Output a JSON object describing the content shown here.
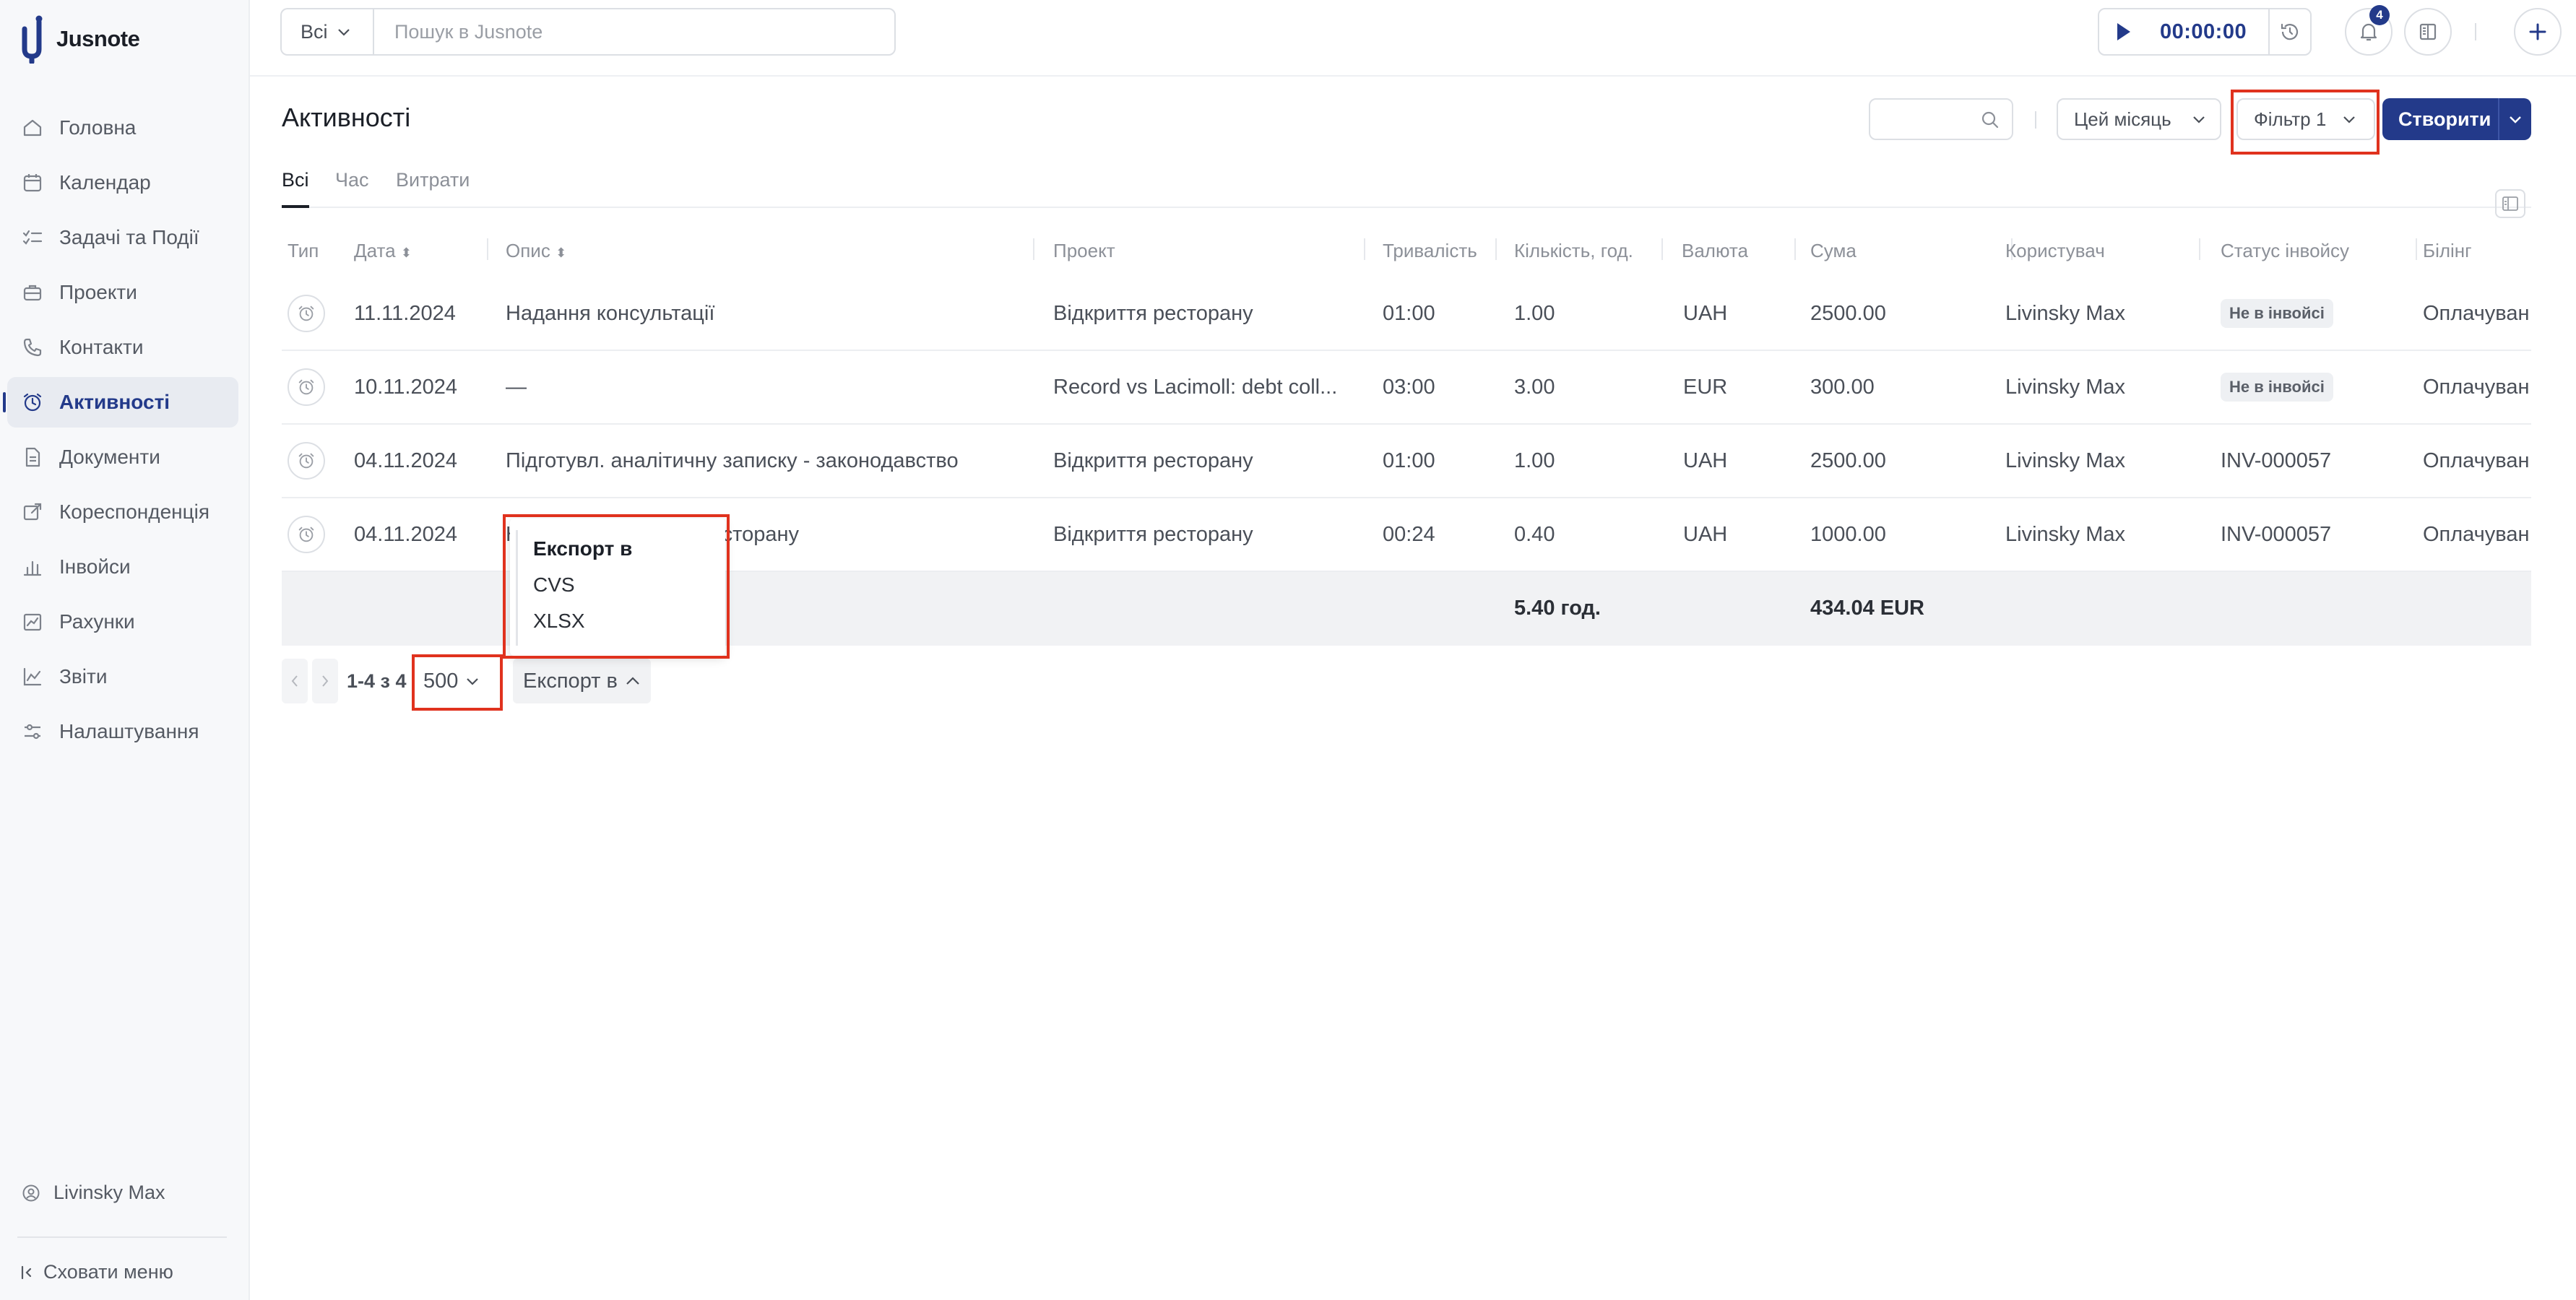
{
  "app": {
    "name": "Jusnote"
  },
  "sidebar": {
    "items": [
      {
        "label": "Головна",
        "icon": "home-icon"
      },
      {
        "label": "Календар",
        "icon": "calendar-icon"
      },
      {
        "label": "Задачі та Події",
        "icon": "checklist-icon"
      },
      {
        "label": "Проекти",
        "icon": "briefcase-icon"
      },
      {
        "label": "Контакти",
        "icon": "phone-icon"
      },
      {
        "label": "Активності",
        "icon": "alarm-clock-icon",
        "active": true
      },
      {
        "label": "Документи",
        "icon": "document-icon"
      },
      {
        "label": "Кореспонденція",
        "icon": "mail-forward-icon"
      },
      {
        "label": "Інвойси",
        "icon": "bar-chart-icon"
      },
      {
        "label": "Рахунки",
        "icon": "invoice-chart-icon"
      },
      {
        "label": "Звіти",
        "icon": "line-chart-icon"
      },
      {
        "label": "Налаштування",
        "icon": "sliders-icon"
      }
    ],
    "user": "Livinsky Max",
    "hide_menu": "Сховати меню"
  },
  "topbar": {
    "scope": "Всі",
    "search_placeholder": "Пошук в Jusnote",
    "timer": "00:00:00",
    "notifications_count": "4"
  },
  "page": {
    "title": "Активності",
    "period": "Цей місяць",
    "filter": "Фільтр 1",
    "create": "Створити",
    "tabs": [
      "Всі",
      "Час",
      "Витрати"
    ],
    "active_tab": 0
  },
  "table": {
    "columns": [
      "Тип",
      "Дата",
      "Опис",
      "Проект",
      "Тривалість",
      "Кількість, год.",
      "Валюта",
      "Сума",
      "Користувач",
      "Статус інвойсу",
      "Білінг"
    ],
    "rows": [
      {
        "date": "11.11.2024",
        "description": "Надання консультації",
        "project": "Відкриття ресторану",
        "duration": "01:00",
        "qty": "1.00",
        "currency": "UAH",
        "amount": "2500.00",
        "user": "Livinsky Max",
        "status": "Не в інвойсі",
        "status_pill": true,
        "billing": "Оплачуван"
      },
      {
        "date": "10.11.2024",
        "description": "—",
        "project": "Record vs Lacimoll: debt coll...",
        "duration": "03:00",
        "qty": "3.00",
        "currency": "EUR",
        "amount": "300.00",
        "user": "Livinsky Max",
        "status": "Не в інвойсі",
        "status_pill": true,
        "billing": "Оплачуван"
      },
      {
        "date": "04.11.2024",
        "description": "Підготувл. аналітичну записку - законодавство",
        "project": "Відкриття ресторану",
        "duration": "01:00",
        "qty": "1.00",
        "currency": "UAH",
        "amount": "2500.00",
        "user": "Livinsky Max",
        "status": "INV-000057",
        "status_pill": false,
        "billing": "Оплачуван"
      },
      {
        "date": "04.11.2024",
        "description": "Н... щодо відкриття ресторану",
        "project": "Відкриття ресторану",
        "duration": "00:24",
        "qty": "0.40",
        "currency": "UAH",
        "amount": "1000.00",
        "user": "Livinsky Max",
        "status": "INV-000057",
        "status_pill": false,
        "billing": "Оплачуван"
      }
    ],
    "totals": {
      "qty": "5.40 год.",
      "amount": "434.04 EUR"
    }
  },
  "pagination": {
    "range": "1-4 з 4",
    "page_size": "500",
    "export_label": "Експорт в"
  },
  "export_menu": {
    "title": "Експорт в",
    "options": [
      "CVS",
      "XLSX"
    ]
  },
  "colors": {
    "accent": "#233a8a",
    "highlight": "#e0321e"
  }
}
